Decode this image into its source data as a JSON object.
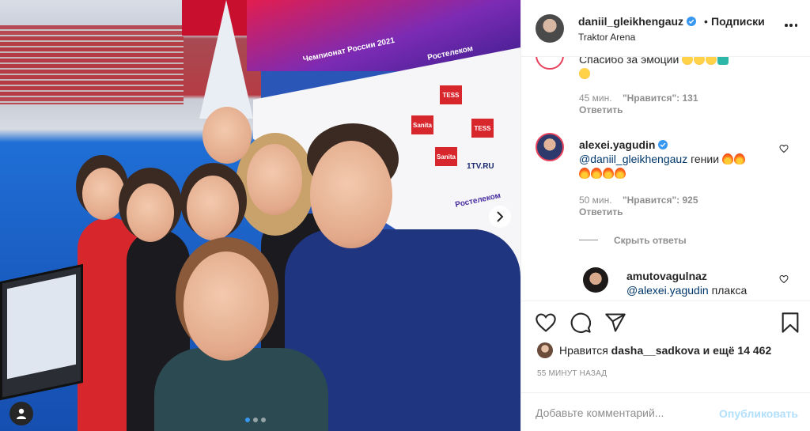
{
  "post": {
    "author": "daniil_gleikhengauz",
    "separator": "•",
    "follow_label": "Подписки",
    "location": "Traktor Arena"
  },
  "comments": [
    {
      "text": "Спасибо за эмоции",
      "time": "45 мин.",
      "likes": "\"Нравится\": 131",
      "reply_label": "Ответить",
      "emojis": [
        "face-icon",
        "face-icon",
        "face-icon",
        "robot-icon",
        "astonished-face-icon"
      ]
    },
    {
      "username": "alexei.yagudin",
      "mention": "@daniil_gleikhengauz",
      "text": "гении",
      "time": "50 мин.",
      "likes": "\"Нравится\": 925",
      "reply_label": "Ответить",
      "emojis": [
        "fire-icon",
        "fire-icon",
        "fire-icon",
        "fire-icon",
        "fire-icon",
        "fire-icon"
      ]
    }
  ],
  "hide_replies_label": "Скрыть ответы",
  "reply": {
    "username": "amutovagulnaz",
    "mention": "@alexei.yagudin",
    "text": "плакса"
  },
  "likes": {
    "prefix": "Нравится",
    "user": "dasha__sadkova",
    "suffix": "и ещё 14 462"
  },
  "time_ago": "55 МИНУТ НАЗАД",
  "comment_input": {
    "placeholder": "Добавьте комментарий..."
  },
  "post_button_label": "Опубликовать",
  "photo": {
    "sponsors": [
      "Ростелеком",
      "TESS",
      "Sanita",
      "1TV.RU",
      "Ростелеком"
    ],
    "banner_text": "Чемпионат России 2021",
    "carousel": {
      "count": 3,
      "active": 1
    }
  },
  "colors": {
    "link": "#00376b",
    "verified": "#3897f0",
    "muted": "#8e8e8e",
    "post_button_disabled": "#b2dffc"
  }
}
